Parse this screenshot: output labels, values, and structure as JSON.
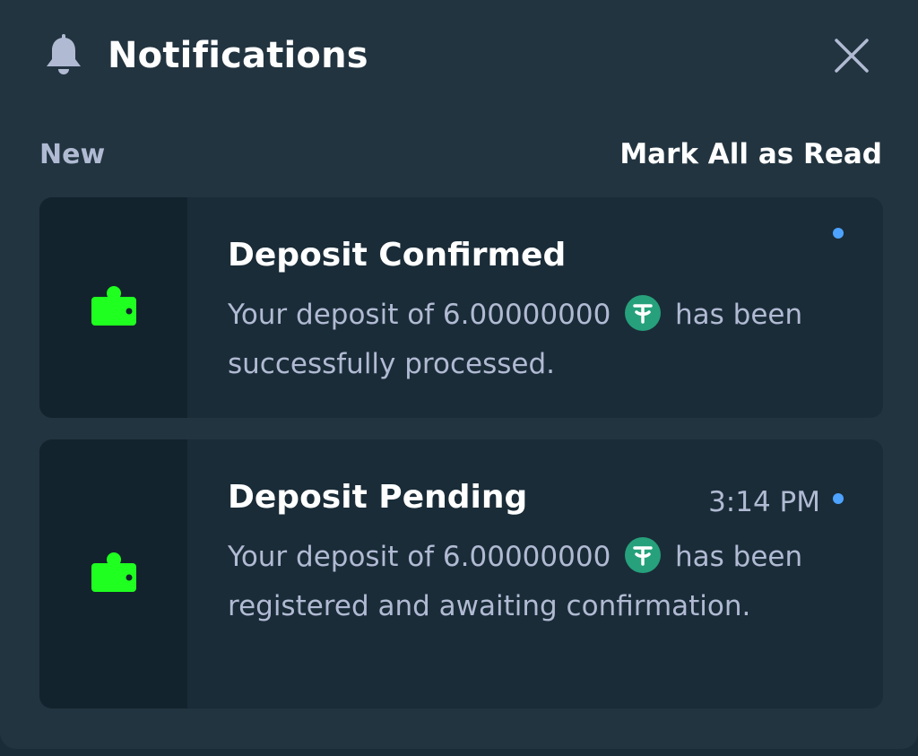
{
  "header": {
    "title": "Notifications",
    "bell_icon": "bell-icon",
    "close_icon": "close-icon"
  },
  "subheader": {
    "new_label": "New",
    "mark_all_label": "Mark All as Read"
  },
  "notifications": [
    {
      "title": "Deposit Confirmed",
      "text_before": "Your deposit of 6.00000000",
      "text_after": "has been successfully processed.",
      "currency_icon": "tether-icon",
      "icon": "wallet-icon",
      "time": "",
      "unread": true
    },
    {
      "title": "Deposit Pending",
      "text_before": "Your deposit of 6.00000000",
      "text_after": "has been registered and awaiting confirmation.",
      "currency_icon": "tether-icon",
      "icon": "wallet-icon",
      "time": "3:14 PM",
      "unread": true
    }
  ],
  "colors": {
    "panel_bg": "#223440",
    "card_bg": "#1a2c38",
    "icon_column_bg": "#13232d",
    "wallet_green": "#1fff20",
    "unread_dot": "#4da3ff",
    "tether_green": "#26a17b",
    "muted_text": "#b1bad3"
  }
}
